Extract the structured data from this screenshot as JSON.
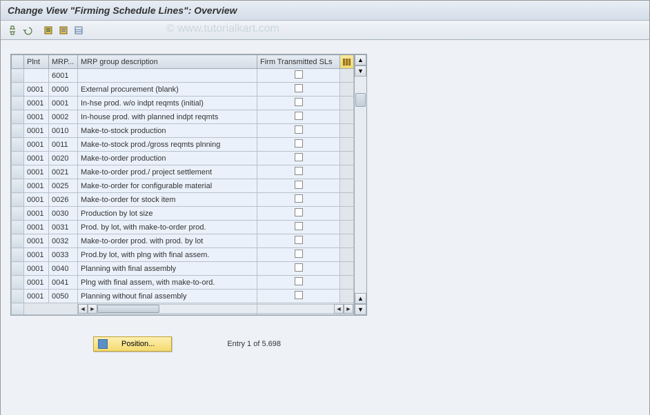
{
  "title": "Change View \"Firming Schedule Lines\": Overview",
  "watermark": "© www.tutorialkart.com",
  "columns": {
    "plnt": "Plnt",
    "mrp": "MRP...",
    "desc": "MRP group description",
    "firm": "Firm Transmitted SLs"
  },
  "rows": [
    {
      "plnt": "",
      "mrp": "6001",
      "desc": "",
      "firm": false
    },
    {
      "plnt": "0001",
      "mrp": "0000",
      "desc": "External procurement           (blank)",
      "firm": false
    },
    {
      "plnt": "0001",
      "mrp": "0001",
      "desc": "In-hse prod. w/o indpt reqmts (initial)",
      "firm": false
    },
    {
      "plnt": "0001",
      "mrp": "0002",
      "desc": "In-house prod. with planned indpt reqmts",
      "firm": false
    },
    {
      "plnt": "0001",
      "mrp": "0010",
      "desc": "Make-to-stock production",
      "firm": false
    },
    {
      "plnt": "0001",
      "mrp": "0011",
      "desc": "Make-to-stock prod./gross reqmts plnning",
      "firm": false
    },
    {
      "plnt": "0001",
      "mrp": "0020",
      "desc": "Make-to-order production",
      "firm": false
    },
    {
      "plnt": "0001",
      "mrp": "0021",
      "desc": "Make-to-order prod./ project settlement",
      "firm": false
    },
    {
      "plnt": "0001",
      "mrp": "0025",
      "desc": "Make-to-order for configurable material",
      "firm": false
    },
    {
      "plnt": "0001",
      "mrp": "0026",
      "desc": "Make-to-order for stock item",
      "firm": false
    },
    {
      "plnt": "0001",
      "mrp": "0030",
      "desc": "Production by lot size",
      "firm": false
    },
    {
      "plnt": "0001",
      "mrp": "0031",
      "desc": "Prod. by lot, with make-to-order prod.",
      "firm": false
    },
    {
      "plnt": "0001",
      "mrp": "0032",
      "desc": "Make-to-order prod. with prod. by lot",
      "firm": false
    },
    {
      "plnt": "0001",
      "mrp": "0033",
      "desc": "Prod.by lot, with plng with final assem.",
      "firm": false
    },
    {
      "plnt": "0001",
      "mrp": "0040",
      "desc": "Planning with final assembly",
      "firm": false
    },
    {
      "plnt": "0001",
      "mrp": "0041",
      "desc": "Plng with final assem, with make-to-ord.",
      "firm": false
    },
    {
      "plnt": "0001",
      "mrp": "0050",
      "desc": "Planning without final assembly",
      "firm": false
    }
  ],
  "position_button": "Position...",
  "entry_text": "Entry 1 of 5.698"
}
